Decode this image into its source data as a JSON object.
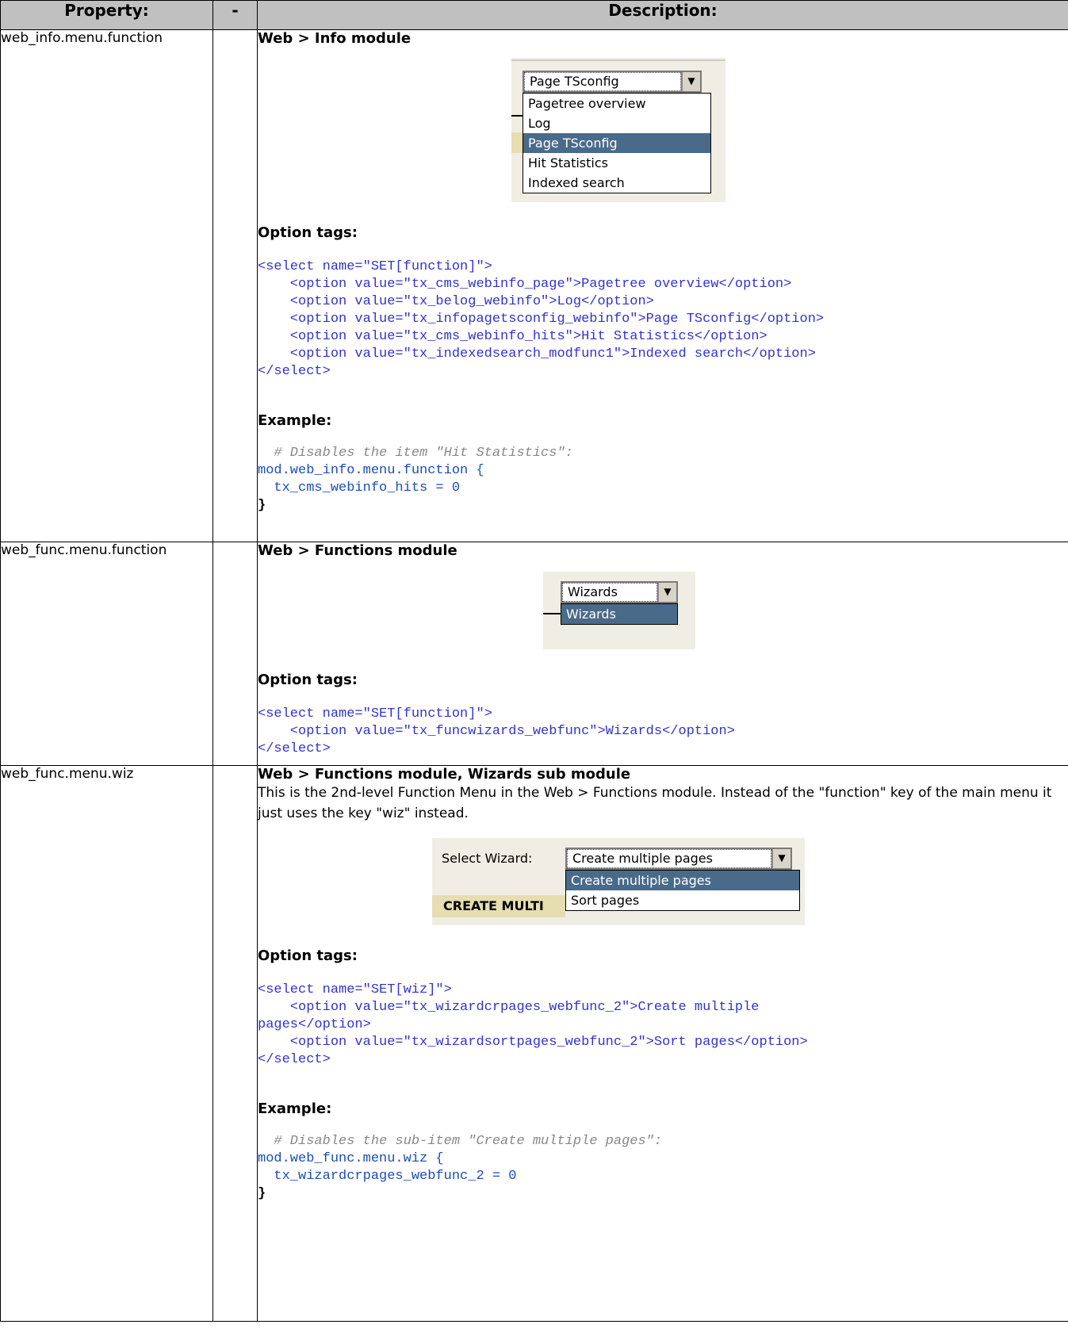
{
  "headers": {
    "property": "Property:",
    "dash": "-",
    "description": "Description:"
  },
  "rows": [
    {
      "property": "web_info.menu.function",
      "title": "Web > Info module",
      "shot": {
        "selected": "Page TSconfig",
        "options": [
          "Pagetree overview",
          "Log",
          "Page TSconfig",
          "Hit Statistics",
          "Indexed search"
        ],
        "highlighted": "Page TSconfig"
      },
      "option_label": "Option tags:",
      "code_select_open": "<select name=\"SET[function]\">",
      "code_options": [
        "    <option value=\"tx_cms_webinfo_page\">Pagetree overview</option>",
        "    <option value=\"tx_belog_webinfo\">Log</option>",
        "    <option value=\"tx_infopagetsconfig_webinfo\">Page TSconfig</option>",
        "    <option value=\"tx_cms_webinfo_hits\">Hit Statistics</option>",
        "    <option value=\"tx_indexedsearch_modfunc1\">Indexed search</option>"
      ],
      "code_select_close": "</select>",
      "example_label": "Example:",
      "example": {
        "comment": "  # Disables the item \"Hit Statistics\":",
        "line1": "mod.web_info.menu.function {",
        "line2": "  tx_cms_webinfo_hits = 0",
        "line3": "}"
      }
    },
    {
      "property": "web_func.menu.function",
      "title": "Web > Functions module",
      "shot": {
        "selected": "Wizards",
        "options": [
          "Wizards"
        ],
        "highlighted": "Wizards"
      },
      "option_label": "Option tags:",
      "code_select_open": "<select name=\"SET[function]\">",
      "code_options": [
        "    <option value=\"tx_funcwizards_webfunc\">Wizards</option>"
      ],
      "code_select_close": "</select>"
    },
    {
      "property": "web_func.menu.wiz",
      "title": "Web > Functions module, Wizards sub module",
      "paragraph": "This is the 2nd-level Function Menu in the Web > Functions module. Instead of the \"function\" key of the main menu it just uses the key \"wiz\" instead.",
      "shot": {
        "label": "Select Wizard:",
        "selected": "Create multiple pages",
        "options": [
          "Create multiple pages",
          "Sort pages"
        ],
        "highlighted": "Create multiple pages",
        "behind_text": "CREATE MULTI"
      },
      "option_label": "Option tags:",
      "code_select_open": "<select name=\"SET[wiz]\">",
      "code_options": [
        "    <option value=\"tx_wizardcrpages_webfunc_2\">Create multiple",
        "pages</option>",
        "    <option value=\"tx_wizardsortpages_webfunc_2\">Sort pages</option>"
      ],
      "code_select_close": "</select>",
      "example_label": "Example:",
      "example": {
        "comment": "  # Disables the sub-item \"Create multiple pages\":",
        "line1": "mod.web_func.menu.wiz {",
        "line2": "  tx_wizardcrpages_webfunc_2 = 0",
        "line3": "}"
      }
    }
  ]
}
